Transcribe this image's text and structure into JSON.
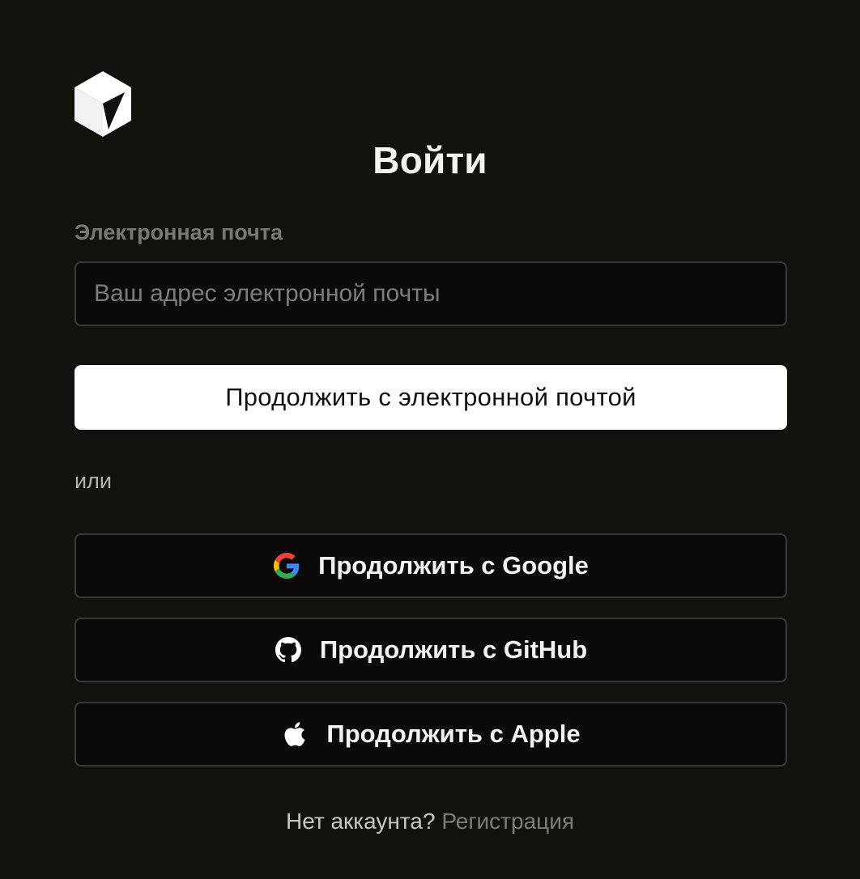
{
  "auth": {
    "title": "Войти",
    "email_label": "Электронная почта",
    "email_placeholder": "Ваш адрес электронной почты",
    "email_value": "",
    "continue_email_label": "Продолжить с электронной почтой",
    "divider_text": "или",
    "providers": {
      "google": {
        "label": "Продолжить с Google",
        "icon": "google-icon"
      },
      "github": {
        "label": "Продолжить с GitHub",
        "icon": "github-icon"
      },
      "apple": {
        "label": "Продолжить с Apple",
        "icon": "apple-icon"
      }
    },
    "footer": {
      "question": "Нет аккаунта?",
      "signup_label": "Регистрация"
    }
  },
  "colors": {
    "background": "#12110e",
    "primary_button_bg": "#ffffff",
    "border": "#3a3935",
    "muted_text": "#7e7c78"
  }
}
